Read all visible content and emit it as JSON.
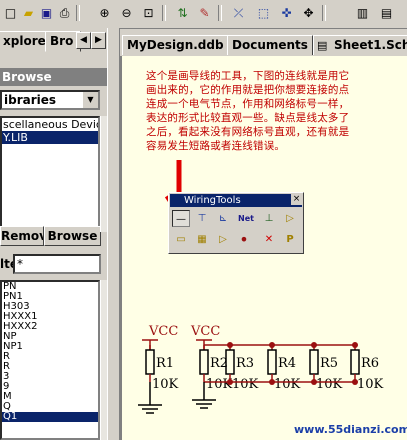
{
  "toolbar": {
    "buttons": [
      {
        "name": "new-icon",
        "glyph": "□"
      },
      {
        "name": "open-folder-icon",
        "glyph": "▰"
      },
      {
        "name": "save-icon",
        "glyph": "▣"
      },
      {
        "name": "print-icon",
        "glyph": "⎙"
      },
      {
        "name": "zoom-in-icon",
        "glyph": "⊕"
      },
      {
        "name": "zoom-out-icon",
        "glyph": "⊖"
      },
      {
        "name": "zoom-fit-icon",
        "glyph": "⊡"
      },
      {
        "name": "hierarchy-icon",
        "glyph": "⇅"
      },
      {
        "name": "pencil-icon",
        "glyph": "✎"
      },
      {
        "name": "cross-probe-icon",
        "glyph": "⤫"
      },
      {
        "name": "select-area-icon",
        "glyph": "⬚"
      },
      {
        "name": "deselect-icon",
        "glyph": "✜"
      },
      {
        "name": "move-icon",
        "glyph": "✥"
      },
      {
        "name": "library-icon",
        "glyph": "▥"
      },
      {
        "name": "chip-icon",
        "glyph": "▤"
      }
    ]
  },
  "left_panel": {
    "tabs": [
      "xplorer",
      "Bro"
    ],
    "browse_title": "Browse",
    "library_combo": "ibraries",
    "libraries": [
      "scellaneous Devices",
      "Y.LIB"
    ],
    "buttons": {
      "remove": "Remov",
      "browse": "Browse"
    },
    "filter_label": "lte",
    "filter_value": "*",
    "components": [
      "PN",
      "PN1",
      "H303",
      "HXXX1",
      "HXXX2",
      "NP",
      "NP1",
      "R",
      "R",
      "3",
      "9",
      "M",
      "Q",
      "Q1"
    ]
  },
  "doc_tabs": [
    "MyDesign.ddb",
    "Documents",
    "Sheet1.Sch"
  ],
  "annotation": "这个是画导线的工具，下图的连线就是用它画出来的，它的作用就是把你想要连接的点连成一个电气节点，作用和网络标号一样，表达的形式比较直观一些。缺点是线太多了之后，看起来没有网络标号直观，还有就是容易发生短路或者连线错误。",
  "palette": {
    "title": "WiringTools",
    "close_glyph": "×",
    "row1": [
      {
        "name": "place-wire-icon",
        "glyph": "—"
      },
      {
        "name": "place-bus-icon",
        "glyph": "⊤"
      },
      {
        "name": "bus-entry-icon",
        "glyph": "⊾"
      },
      {
        "name": "net-label-icon",
        "glyph": "Net"
      },
      {
        "name": "power-port-icon",
        "glyph": "⊥"
      },
      {
        "name": "place-part-icon",
        "glyph": "▷"
      }
    ],
    "row2": [
      {
        "name": "sheet-symbol-icon",
        "glyph": "▭"
      },
      {
        "name": "sheet-entry-icon",
        "glyph": "▦"
      },
      {
        "name": "port-icon",
        "glyph": "▷"
      },
      {
        "name": "junction-icon",
        "glyph": "•"
      },
      {
        "name": "no-erc-icon",
        "glyph": "✕"
      },
      {
        "name": "pcb-layout-icon",
        "glyph": "P"
      }
    ]
  },
  "schematic": {
    "vcc_labels": [
      "VCC",
      "VCC"
    ],
    "resistors": [
      {
        "ref": "R1",
        "value": "10K"
      },
      {
        "ref": "R2",
        "value": "10K"
      },
      {
        "ref": "R3",
        "value": "10K"
      },
      {
        "ref": "R4",
        "value": "10K"
      },
      {
        "ref": "R5",
        "value": "10K"
      },
      {
        "ref": "R6",
        "value": "10K"
      }
    ]
  },
  "footer": {
    "url": "www.55dianzi.com"
  },
  "colors": {
    "wire": "#9b1010",
    "annotation": "#c00000",
    "junction": "#9b1010",
    "arrow": "#e00000",
    "canvas": "#ffffe6"
  }
}
